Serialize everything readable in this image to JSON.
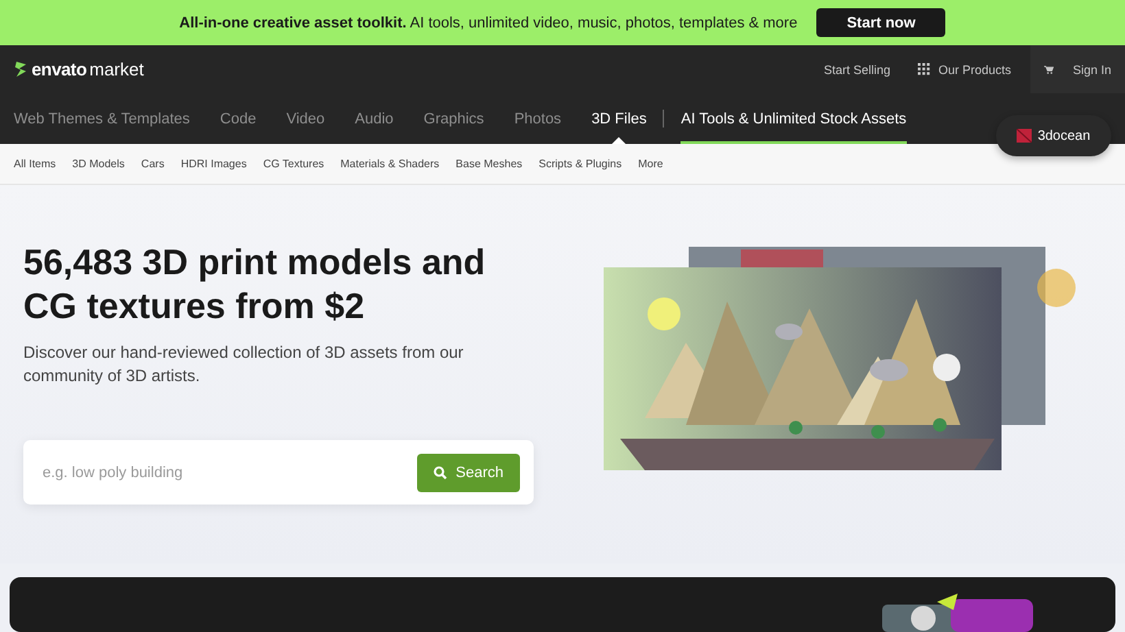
{
  "promo": {
    "text": "**All-in-one creative asset toolkit.** AI tools, unlimited video, music, photos, templates & more",
    "button": "Start now"
  },
  "header": {
    "logo": {
      "brand": "envato",
      "product": "market"
    },
    "links": [
      "Start Selling"
    ],
    "products": "Our Products",
    "sign_in": "Sign In"
  },
  "categories": [
    {
      "label": "Web Themes & Templates",
      "selected": false
    },
    {
      "label": "Code",
      "selected": false
    },
    {
      "label": "Video",
      "selected": false
    },
    {
      "label": "Audio",
      "selected": false
    },
    {
      "label": "Graphics",
      "selected": false
    },
    {
      "label": "Photos",
      "selected": false
    },
    {
      "label": "3D Files",
      "selected": true
    }
  ],
  "featured_link": "AI Tools & Unlimited Stock Assets",
  "site_badge": "3docean",
  "subcategories": [
    "All Items",
    "3D Models",
    "Cars",
    "HDRI Images",
    "CG Textures",
    "Materials & Shaders",
    "Base Meshes",
    "Scripts & Plugins",
    "More"
  ],
  "hero": {
    "title": "56,483 3D print models and CG textures from $2",
    "subtitle": "Discover our hand-reviewed collection of 3D assets from our community of 3D artists.",
    "search": {
      "placeholder": "e.g. low poly building",
      "button": "Search"
    }
  }
}
